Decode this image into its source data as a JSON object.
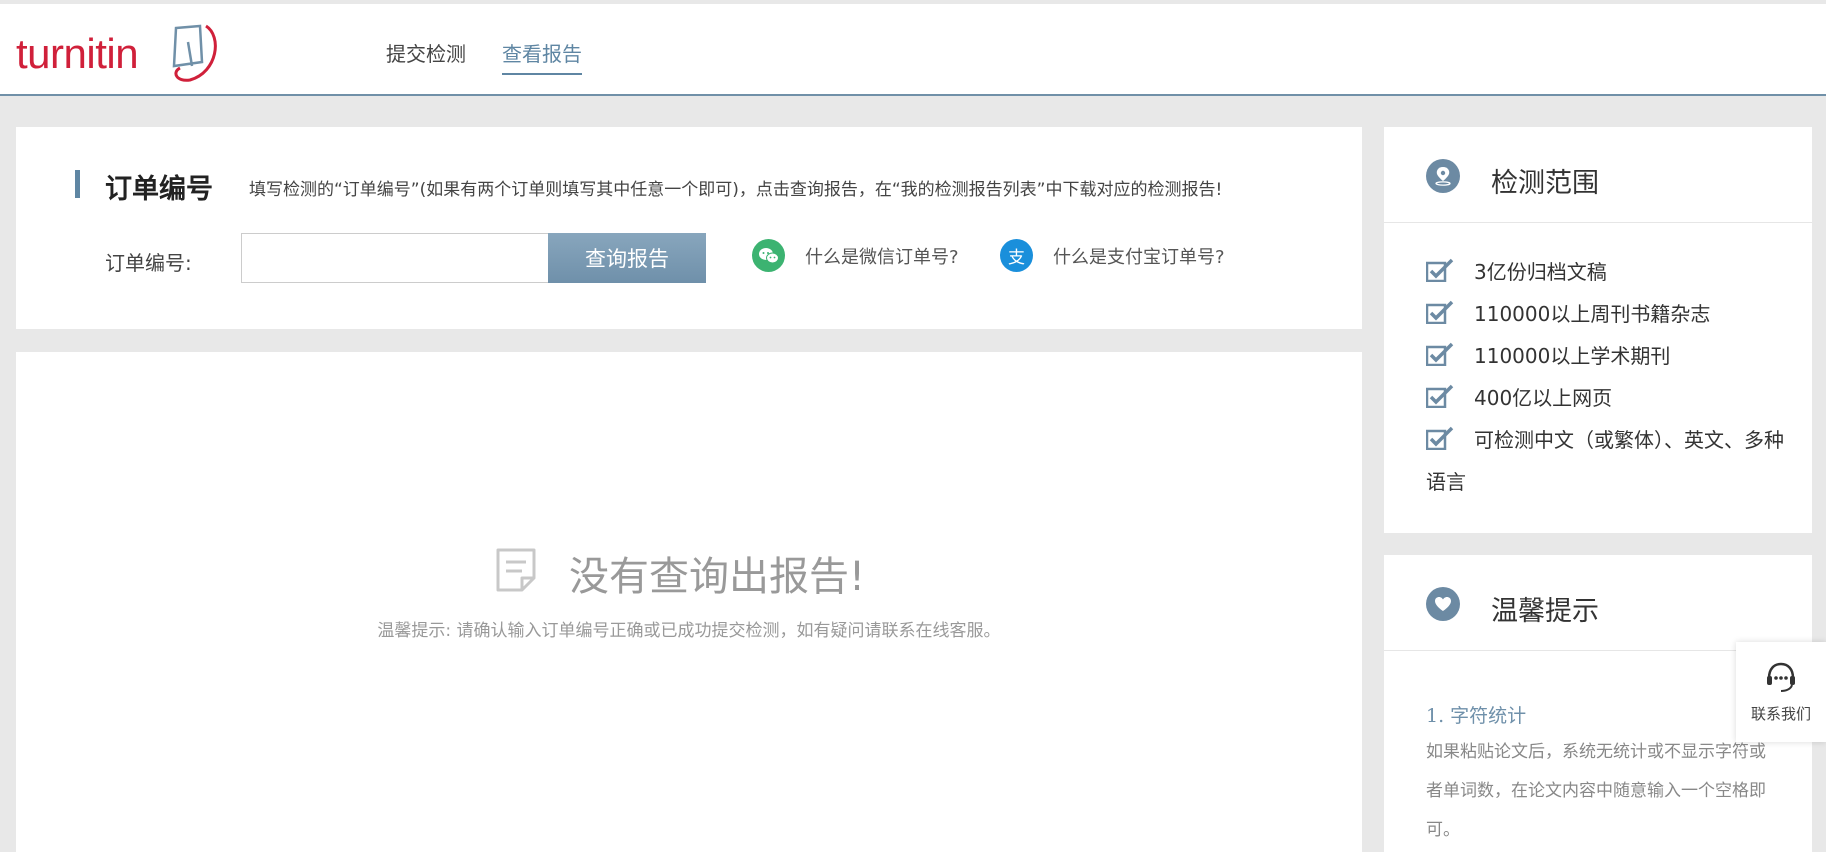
{
  "header": {
    "logo_text": "turnitin",
    "nav": [
      {
        "label": "提交检测",
        "active": false
      },
      {
        "label": "查看报告",
        "active": true
      }
    ]
  },
  "order": {
    "title": "订单编号",
    "description": "填写检测的“订单编号”(如果有两个订单则填写其中任意一个即可)，点击查询报告，在“我的检测报告列表”中下载对应的检测报告!",
    "field_label": "订单编号:",
    "input_value": "",
    "input_placeholder": "",
    "query_button": "查询报告",
    "wechat_help": "什么是微信订单号?",
    "alipay_help": "什么是支付宝订单号?",
    "alipay_glyph": "支"
  },
  "result": {
    "empty_title": "没有查询出报告!",
    "empty_tip": "温馨提示: 请确认输入订单编号正确或已成功提交检测，如有疑问请联系在线客服。"
  },
  "scope": {
    "title": "检测范围",
    "items": [
      "3亿份归档文稿",
      "110000以上周刊书籍杂志",
      "110000以上学术期刊",
      "400亿以上网页",
      "可检测中文（或繁体）、英文、多种语言"
    ]
  },
  "tips": {
    "title": "温馨提示",
    "item_title": "1. 字符统计",
    "item_body": "如果粘贴论文后，系统无统计或不显示字符或者单词数，在论文内容中随意输入一个空格即可。"
  },
  "contact": {
    "label": "联系我们"
  },
  "colors": {
    "brand_red": "#d0203a",
    "accent": "#6f90aa",
    "wechat": "#3cb371",
    "alipay": "#1a8fdb"
  }
}
